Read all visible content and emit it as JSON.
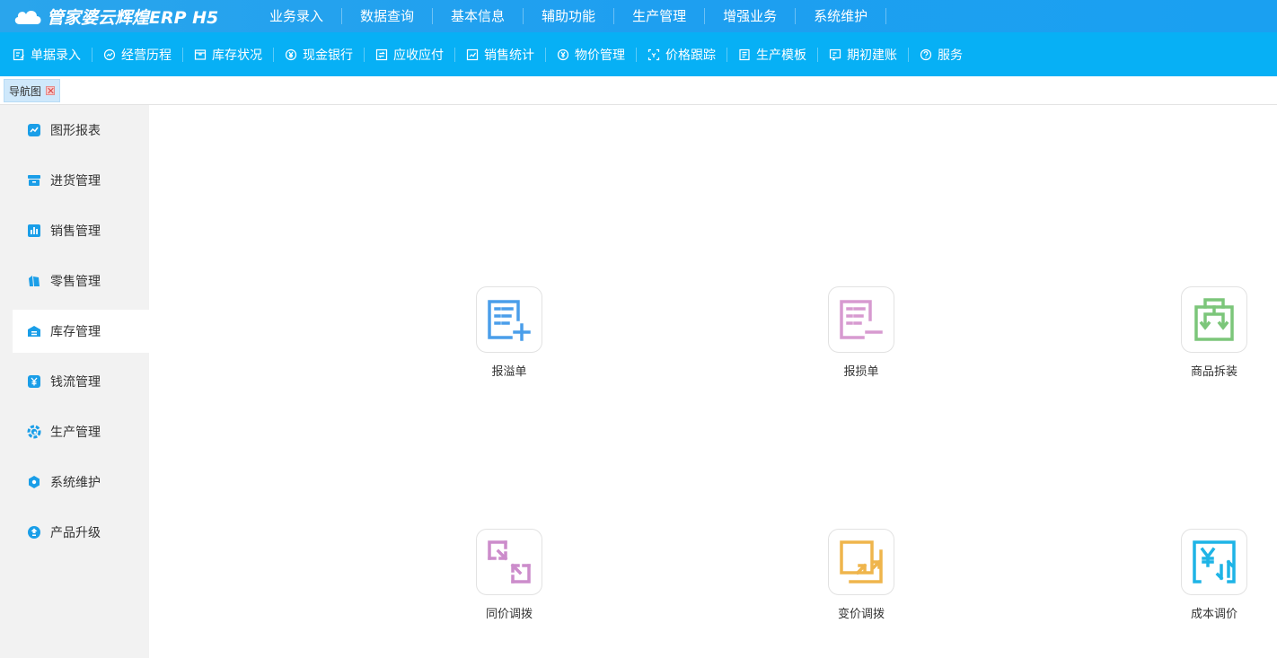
{
  "app": {
    "logo_text": "管家婆云辉煌ERP H5"
  },
  "topnav": [
    "业务录入",
    "数据查询",
    "基本信息",
    "辅助功能",
    "生产管理",
    "增强业务",
    "系统维护"
  ],
  "toolbar": [
    {
      "label": "单据录入",
      "icon": "edit-doc-icon"
    },
    {
      "label": "经营历程",
      "icon": "chart-circle-icon"
    },
    {
      "label": "库存状况",
      "icon": "inventory-box-icon"
    },
    {
      "label": "现金银行",
      "icon": "yuan-coin-icon"
    },
    {
      "label": "应收应付",
      "icon": "receivable-icon"
    },
    {
      "label": "销售统计",
      "icon": "sales-stats-icon"
    },
    {
      "label": "物价管理",
      "icon": "price-coin-icon"
    },
    {
      "label": "价格跟踪",
      "icon": "price-track-icon"
    },
    {
      "label": "生产模板",
      "icon": "template-doc-icon"
    },
    {
      "label": "期初建账",
      "icon": "ledger-icon"
    },
    {
      "label": "服务",
      "icon": "help-circle-icon"
    }
  ],
  "tabs": [
    {
      "label": "导航图"
    }
  ],
  "sidebar": {
    "active_index": 4,
    "items": [
      {
        "label": "图形报表",
        "icon": "line-chart-icon"
      },
      {
        "label": "进货管理",
        "icon": "purchase-box-icon"
      },
      {
        "label": "销售管理",
        "icon": "bar-chart-icon"
      },
      {
        "label": "零售管理",
        "icon": "shopping-bag-icon"
      },
      {
        "label": "库存管理",
        "icon": "warehouse-icon"
      },
      {
        "label": "钱流管理",
        "icon": "money-flow-icon"
      },
      {
        "label": "生产管理",
        "icon": "gear-icon"
      },
      {
        "label": "系统维护",
        "icon": "hexagon-icon"
      },
      {
        "label": "产品升级",
        "icon": "upgrade-icon"
      }
    ]
  },
  "tiles": [
    {
      "label": "报溢单",
      "icon": "doc-plus-icon",
      "color": "#4a9eea"
    },
    {
      "label": "报损单",
      "icon": "doc-minus-icon",
      "color": "#d79ad0"
    },
    {
      "label": "商品拆装",
      "icon": "split-assemble-icon",
      "color": "#7cc67a"
    },
    {
      "label": "同价调拨",
      "icon": "same-price-transfer-icon",
      "color": "#cc8ccb"
    },
    {
      "label": "变价调拨",
      "icon": "change-price-transfer-icon",
      "color": "#efb54c"
    },
    {
      "label": "成本调价",
      "icon": "cost-adjust-icon",
      "color": "#1eb4e6"
    }
  ],
  "colors": {
    "topbar": "#1e9ff0",
    "toolbar": "#07b0f5",
    "sidebar_icon": "#1a9ee8"
  }
}
